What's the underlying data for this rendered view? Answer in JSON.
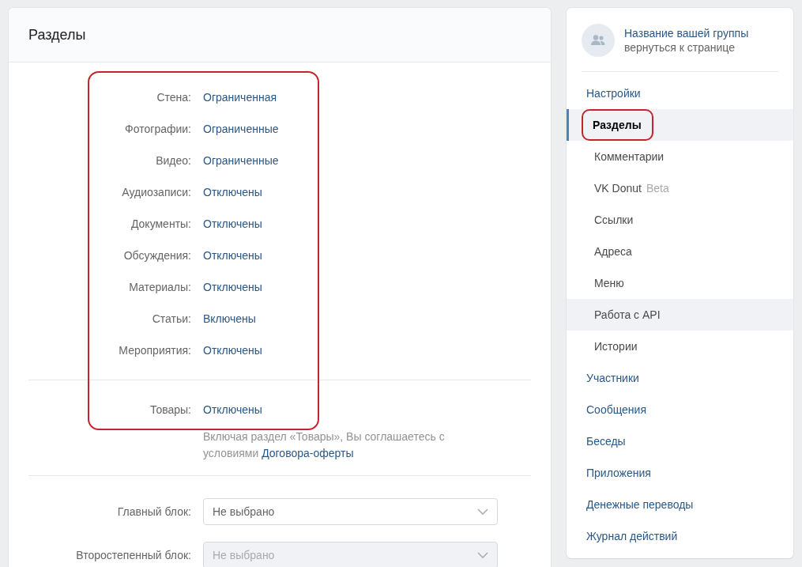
{
  "main": {
    "title": "Разделы",
    "sections": [
      {
        "label": "Стена:",
        "value": "Ограниченная"
      },
      {
        "label": "Фотографии:",
        "value": "Ограниченные"
      },
      {
        "label": "Видео:",
        "value": "Ограниченные"
      },
      {
        "label": "Аудиозаписи:",
        "value": "Отключены"
      },
      {
        "label": "Документы:",
        "value": "Отключены"
      },
      {
        "label": "Обсуждения:",
        "value": "Отключены"
      },
      {
        "label": "Материалы:",
        "value": "Отключены"
      },
      {
        "label": "Статьи:",
        "value": "Включены"
      },
      {
        "label": "Мероприятия:",
        "value": "Отключены"
      }
    ],
    "goods": {
      "label": "Товары:",
      "value": "Отключены",
      "note": "Включая раздел «Товары», Вы соглашаетесь с условиями",
      "note_link": "Договора-оферты"
    },
    "sections_circled": true,
    "selects": [
      {
        "label": "Главный блок:",
        "value": "Не выбрано",
        "disabled": false
      },
      {
        "label": "Второстепенный блок:",
        "value": "Не выбрано",
        "disabled": true
      }
    ]
  },
  "sidebar": {
    "group_name": "Название вашей группы",
    "back_link": "вернуться к странице",
    "items": [
      {
        "label": "Настройки",
        "selected": false,
        "children": [
          {
            "label": "Разделы",
            "selected": true,
            "hovered": false,
            "circled": true
          },
          {
            "label": "Комментарии",
            "selected": false,
            "hovered": false,
            "circled": false
          },
          {
            "label": "VK Donut",
            "badge": "Beta",
            "selected": false,
            "hovered": false,
            "circled": false
          },
          {
            "label": "Ссылки",
            "selected": false,
            "hovered": false,
            "circled": false
          },
          {
            "label": "Адреса",
            "selected": false,
            "hovered": false,
            "circled": false
          },
          {
            "label": "Меню",
            "selected": false,
            "hovered": false,
            "circled": false
          },
          {
            "label": "Работа с API",
            "selected": false,
            "hovered": true,
            "circled": false
          },
          {
            "label": "Истории",
            "selected": false,
            "hovered": false,
            "circled": false
          }
        ]
      },
      {
        "label": "Участники",
        "selected": false
      },
      {
        "label": "Сообщения",
        "selected": false
      },
      {
        "label": "Беседы",
        "selected": false
      },
      {
        "label": "Приложения",
        "selected": false
      },
      {
        "label": "Денежные переводы",
        "selected": false
      },
      {
        "label": "Журнал действий",
        "selected": false
      }
    ]
  }
}
